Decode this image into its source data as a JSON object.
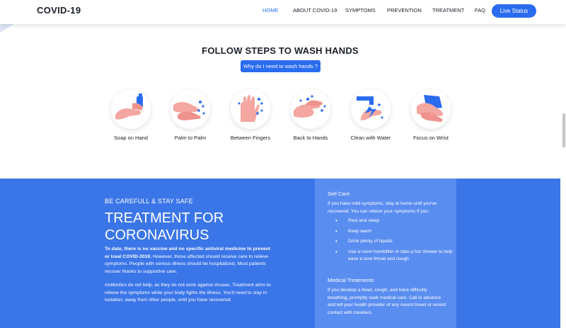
{
  "header": {
    "logo": "COVID-19",
    "nav": [
      {
        "label": "HOME",
        "active": true
      },
      {
        "label": "ABOUT COVID-19",
        "active": false
      },
      {
        "label": "SYMPTOMS",
        "active": false
      },
      {
        "label": "PREVENTION",
        "active": false
      },
      {
        "label": "TREATMENT",
        "active": false
      },
      {
        "label": "FAQ",
        "active": false
      }
    ],
    "cta": "Live Status"
  },
  "wash": {
    "title": "FOLLOW STEPS TO WASH HANDS",
    "button": "Why do I need to wash hands ?",
    "steps": [
      {
        "label": "Soap on Hand",
        "icon": "soap-on-hand-icon"
      },
      {
        "label": "Palm to Palm",
        "icon": "palm-to-palm-icon"
      },
      {
        "label": "Between Fingers",
        "icon": "between-fingers-icon"
      },
      {
        "label": "Back to Hands",
        "icon": "back-to-hands-icon"
      },
      {
        "label": "Clean with Water",
        "icon": "clean-with-water-icon"
      },
      {
        "label": "Focus on Wrist",
        "icon": "focus-on-wrist-icon"
      }
    ]
  },
  "treatment": {
    "kicker": "BE CAREFULL & STAY SAFE",
    "title": "TREATMENT FOR CORONAVIRUS",
    "para1_bold": "To date, there is no vaccine and no specific antiviral medicine to prevent or treat COVID-2019.",
    "para1_rest": " However, those affected should receive care to relieve symptoms. People with serious illness should be hospitalized. Most patients recover thanks to supportive care.",
    "para2": "Antibiotics do not help, as they do not work against viruses. Treatment aims to relieve the symptoms while your body fights the illness. You'll need to stay in isolation, away from other people, until you have recovered.",
    "self_care": {
      "heading": "Self Care",
      "text": "If you have mild symptoms, stay at home until you've recovered. You can relieve your symptoms if you:",
      "items": [
        "Rest and sleep",
        "Keep warm",
        "Drink plenty of liquids",
        "Use a room humidifier or take a hot shower to help ease a sore throat and cough"
      ]
    },
    "medical": {
      "heading": "Medical Treatments",
      "text": "If you develop a fever, cough, and have difficulty breathing, promptly seek medical care. Call in advance and tell your health provider of any recent travel or recent contact with travelers."
    }
  },
  "colors": {
    "accent": "#2a6cf0",
    "section_blue": "#3b76e8",
    "card_blue": "#5a8df0",
    "skin": "#f4a6a0"
  }
}
